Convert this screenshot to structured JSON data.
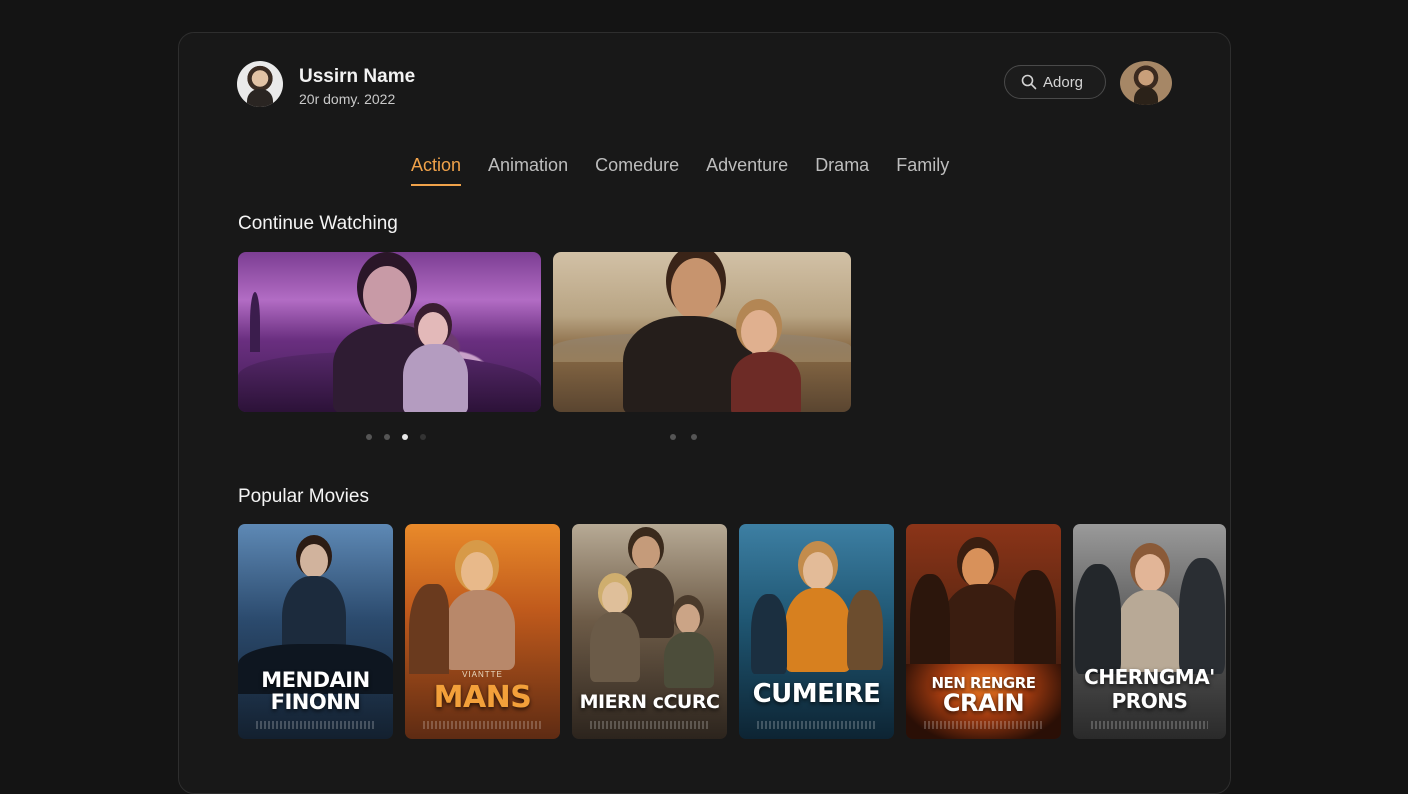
{
  "user": {
    "name": "Ussirn Name",
    "date": "20r domy. 2022"
  },
  "search": {
    "label": "Adorg"
  },
  "tabs": [
    {
      "label": "Action",
      "active": true
    },
    {
      "label": "Animation"
    },
    {
      "label": "Comedure"
    },
    {
      "label": "Adventure"
    },
    {
      "label": "Drama"
    },
    {
      "label": "Family"
    }
  ],
  "continue_watching": {
    "title": "Continue Watching"
  },
  "popular": {
    "title": "Popular Movies",
    "posters": [
      {
        "title_line1": "MENDAIN",
        "title_line2": "FINONN"
      },
      {
        "tagline": "VIANTTE",
        "title_line1": "MANS"
      },
      {
        "title_line1": "MIERN cCURC"
      },
      {
        "title_line1": "CUMEIRE"
      },
      {
        "title_line1": "NEN RENGRE",
        "title_line2": "CRAIN"
      },
      {
        "title_line1": "CHERNGMA'",
        "title_line2": "PRONS"
      }
    ]
  },
  "colors": {
    "accent": "#f0a24a",
    "background": "#141414"
  }
}
